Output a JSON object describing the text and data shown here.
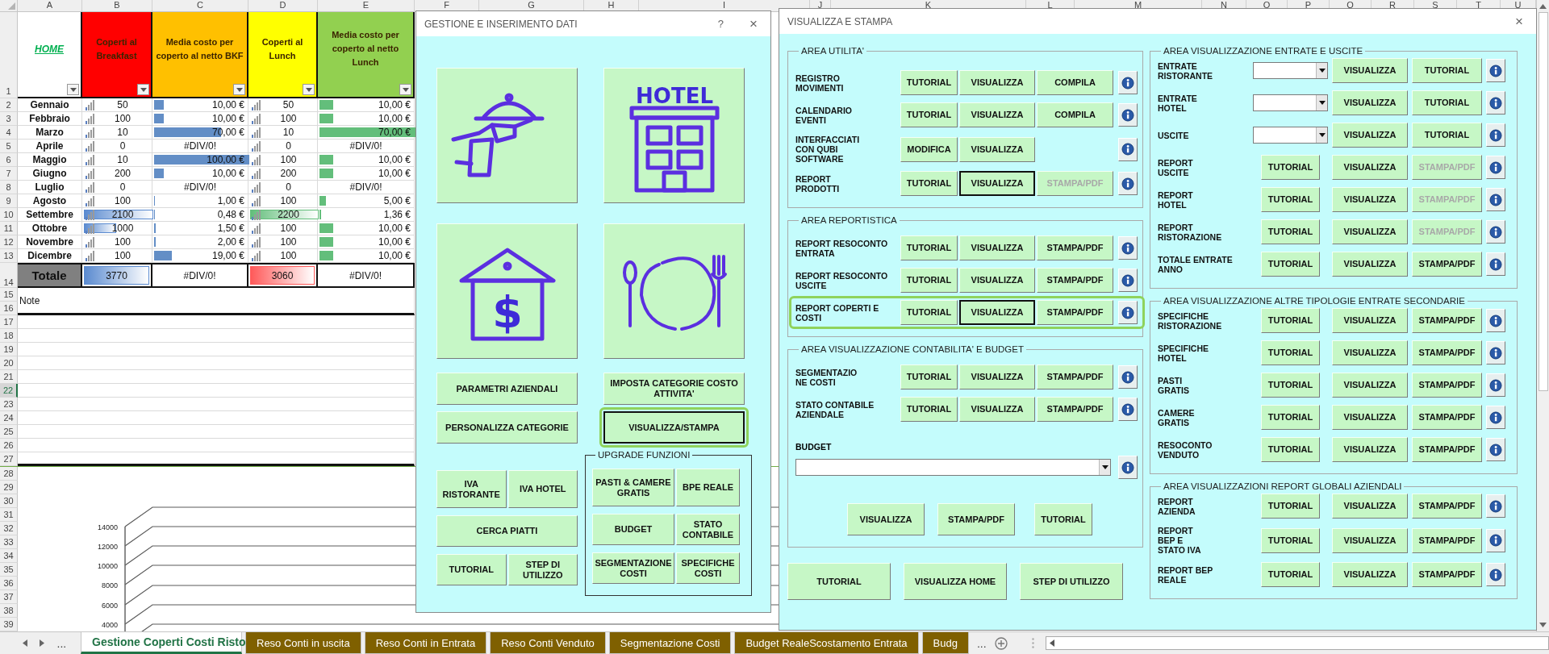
{
  "sheet": {
    "columns": [
      "A",
      "B",
      "C",
      "D",
      "E",
      "F",
      "G",
      "H",
      "I",
      "J",
      "K",
      "L",
      "M",
      "N",
      "O",
      "P",
      "Q",
      "R",
      "S",
      "T",
      "U"
    ],
    "header_row": "1",
    "header": [
      {
        "kind": "link",
        "text": "HOME"
      },
      {
        "kind": "title",
        "text": "Coperti al Breakfast",
        "color": "#ff0000"
      },
      {
        "kind": "title",
        "text": "Media costo per coperto al netto BKF",
        "color": "#ffc000"
      },
      {
        "kind": "title",
        "text": "Coperti al Lunch",
        "color": "#ffff00"
      },
      {
        "kind": "title",
        "text": "Media costo per coperto al netto Lunch",
        "color": "#92d050"
      }
    ],
    "rows": [
      {
        "row": "2",
        "cells": [
          {
            "kind": "label",
            "text": "Gennaio"
          },
          {
            "kind": "count",
            "text": "50"
          },
          {
            "kind": "cost",
            "text": "10,00 €",
            "level": 0.1
          },
          {
            "kind": "count",
            "text": "50"
          },
          {
            "kind": "cost",
            "text": "10,00 €",
            "level": 0.14
          }
        ]
      },
      {
        "row": "3",
        "cells": [
          {
            "kind": "label",
            "text": "Febbraio"
          },
          {
            "kind": "count",
            "text": "100"
          },
          {
            "kind": "cost",
            "text": "10,00 €",
            "level": 0.1
          },
          {
            "kind": "count",
            "text": "100"
          },
          {
            "kind": "cost",
            "text": "10,00 €",
            "level": 0.14
          }
        ]
      },
      {
        "row": "4",
        "cells": [
          {
            "kind": "label",
            "text": "Marzo"
          },
          {
            "kind": "count",
            "text": "10"
          },
          {
            "kind": "cost",
            "text": "70,00 €",
            "level": 0.7
          },
          {
            "kind": "count",
            "text": "10"
          },
          {
            "kind": "cost",
            "text": "70,00 €",
            "level": 1
          }
        ]
      },
      {
        "row": "5",
        "cells": [
          {
            "kind": "label",
            "text": "Aprile"
          },
          {
            "kind": "count",
            "text": "0"
          },
          {
            "kind": "error",
            "text": "#DIV/0!"
          },
          {
            "kind": "count",
            "text": "0"
          },
          {
            "kind": "error",
            "text": "#DIV/0!"
          }
        ]
      },
      {
        "row": "6",
        "cells": [
          {
            "kind": "label",
            "text": "Maggio"
          },
          {
            "kind": "count",
            "text": "10"
          },
          {
            "kind": "cost",
            "text": "100,00 €",
            "level": 1
          },
          {
            "kind": "count",
            "text": "100"
          },
          {
            "kind": "cost",
            "text": "10,00 €",
            "level": 0.14
          }
        ]
      },
      {
        "row": "7",
        "cells": [
          {
            "kind": "label",
            "text": "Giugno"
          },
          {
            "kind": "count",
            "text": "200"
          },
          {
            "kind": "cost",
            "text": "10,00 €",
            "level": 0.1
          },
          {
            "kind": "count",
            "text": "200"
          },
          {
            "kind": "cost",
            "text": "10,00 €",
            "level": 0.14
          }
        ]
      },
      {
        "row": "8",
        "cells": [
          {
            "kind": "label",
            "text": "Luglio"
          },
          {
            "kind": "count",
            "text": "0"
          },
          {
            "kind": "error",
            "text": "#DIV/0!"
          },
          {
            "kind": "count",
            "text": "0"
          },
          {
            "kind": "error",
            "text": "#DIV/0!"
          }
        ]
      },
      {
        "row": "9",
        "cells": [
          {
            "kind": "label",
            "text": "Agosto"
          },
          {
            "kind": "count",
            "text": "100"
          },
          {
            "kind": "cost",
            "text": "1,00 €",
            "level": 0.01
          },
          {
            "kind": "count",
            "text": "100"
          },
          {
            "kind": "cost",
            "text": "5,00 €",
            "level": 0.07
          }
        ]
      },
      {
        "row": "10",
        "cells": [
          {
            "kind": "label",
            "text": "Settembre"
          },
          {
            "kind": "count",
            "text": "2100",
            "level": 1
          },
          {
            "kind": "cost",
            "text": "0,48 €",
            "level": 0.01
          },
          {
            "kind": "count",
            "text": "2200",
            "level": 1
          },
          {
            "kind": "cost",
            "text": "1,36 €",
            "level": 0.02
          }
        ]
      },
      {
        "row": "11",
        "cells": [
          {
            "kind": "label",
            "text": "Ottobre"
          },
          {
            "kind": "count",
            "text": "1000",
            "level": 0.47
          },
          {
            "kind": "cost",
            "text": "1,50 €",
            "level": 0.015
          },
          {
            "kind": "count",
            "text": "100"
          },
          {
            "kind": "cost",
            "text": "10,00 €",
            "level": 0.14
          }
        ]
      },
      {
        "row": "12",
        "cells": [
          {
            "kind": "label",
            "text": "Novembre"
          },
          {
            "kind": "count",
            "text": "100"
          },
          {
            "kind": "cost",
            "text": "2,00 €",
            "level": 0.02
          },
          {
            "kind": "count",
            "text": "100"
          },
          {
            "kind": "cost",
            "text": "10,00 €",
            "level": 0.14
          }
        ]
      },
      {
        "row": "13",
        "cells": [
          {
            "kind": "label",
            "text": "Dicembre"
          },
          {
            "kind": "count",
            "text": "100"
          },
          {
            "kind": "cost",
            "text": "19,00 €",
            "level": 0.19
          },
          {
            "kind": "count",
            "text": "100"
          },
          {
            "kind": "cost",
            "text": "10,00 €",
            "level": 0.14
          }
        ]
      }
    ],
    "total": {
      "row": "14",
      "cells": [
        {
          "kind": "label",
          "text": "Totale"
        },
        {
          "kind": "total",
          "text": "3770",
          "color": "#5b8bd0"
        },
        {
          "kind": "error",
          "text": "#DIV/0!"
        },
        {
          "kind": "total",
          "text": "3060",
          "color": "#ff5a5a"
        },
        {
          "kind": "error",
          "text": "#DIV/0!"
        }
      ]
    },
    "note": {
      "rows": [
        "15",
        "16"
      ],
      "text": "Note"
    },
    "blank_rows": [
      {
        "row": "17",
        "selected": false
      },
      {
        "row": "18",
        "selected": false
      },
      {
        "row": "19",
        "selected": false
      },
      {
        "row": "20",
        "selected": false
      },
      {
        "row": "21",
        "selected": false
      },
      {
        "row": "22",
        "selected": true
      },
      {
        "row": "23",
        "selected": false
      },
      {
        "row": "24",
        "selected": false
      },
      {
        "row": "25",
        "selected": false
      },
      {
        "row": "26",
        "selected": false
      },
      {
        "row": "27",
        "selected": false
      }
    ],
    "chart": {
      "rows": [
        "28",
        "29",
        "30",
        "31",
        "32",
        "33",
        "34",
        "35",
        "36",
        "37",
        "38",
        "39"
      ],
      "tick_labels": [
        "14000",
        "12000",
        "10000",
        "8000",
        "6000",
        "4000"
      ]
    }
  },
  "sheet_tabs": [
    {
      "label": "Gestione Coperti Costi Risto",
      "selected": true
    },
    {
      "label": "Reso Conti in uscita",
      "selected": false
    },
    {
      "label": "Reso Conti in Entrata",
      "selected": false
    },
    {
      "label": "Reso Conti Venduto",
      "selected": false
    },
    {
      "label": "Segmentazione Costi",
      "selected": false
    },
    {
      "label": "Budget RealeScostamento Entrata",
      "selected": false
    },
    {
      "label": "Budg",
      "selected": false
    }
  ],
  "tab_bar": {
    "more_left": "...",
    "more_right": "..."
  },
  "gestione": {
    "title": "GESTIONE E INSERIMENTO DATI",
    "help": "?",
    "close": "×",
    "tiles": [
      {
        "kind": "waiter"
      },
      {
        "kind": "hotel",
        "sign": "HOTEL"
      },
      {
        "kind": "money_house",
        "sign": "$"
      },
      {
        "kind": "dining"
      }
    ],
    "setup_buttons": [
      {
        "label": "PARAMETRI AZIENDALI"
      },
      {
        "label": "PERSONALIZZA CATEGORIE"
      },
      {
        "label": "IMPOSTA CATEGORIE COSTO ATTIVITA'"
      },
      {
        "label": "VISUALIZZA/STAMPA",
        "highlighted": true,
        "focused": true
      }
    ],
    "tool_rows": [
      [
        {
          "label": "IVA RISTORANTE"
        },
        {
          "label": "IVA HOTEL"
        }
      ],
      [
        {
          "label": "CERCA PIATTI"
        }
      ],
      [
        {
          "label": "TUTORIAL"
        },
        {
          "label": "STEP DI UTILIZZO"
        }
      ]
    ],
    "upgrade": {
      "title": "UPGRADE FUNZIONI",
      "rows": [
        [
          {
            "label": "PASTI & CAMERE GRATIS"
          },
          {
            "label": "BPE REALE"
          }
        ],
        [
          {
            "label": "BUDGET"
          },
          {
            "label": "STATO CONTABILE"
          }
        ],
        [
          {
            "label": "SEGMENTAZIONE COSTI"
          },
          {
            "label": "SPECIFICHE COSTI"
          }
        ]
      ]
    }
  },
  "visualizza": {
    "title": "VISUALIZZA E STAMPA",
    "close": "×",
    "left_groups": [
      {
        "title": "AREA UTILITA'",
        "rows": [
          {
            "label": "REGISTRO\nMOVIMENTI",
            "controls": [
              {
                "kind": "button",
                "label": "TUTORIAL"
              },
              {
                "kind": "button",
                "label": "VISUALIZZA"
              },
              {
                "kind": "button",
                "label": "COMPILA"
              },
              {
                "kind": "info"
              }
            ]
          },
          {
            "label": "CALENDARIO\nEVENTI",
            "controls": [
              {
                "kind": "button",
                "label": "TUTORIAL"
              },
              {
                "kind": "button",
                "label": "VISUALIZZA"
              },
              {
                "kind": "button",
                "label": "COMPILA"
              },
              {
                "kind": "info"
              }
            ]
          },
          {
            "label": "INTERFACCIATI\nCON QUBI\nSOFTWARE",
            "controls": [
              {
                "kind": "button",
                "label": "MODIFICA"
              },
              {
                "kind": "button",
                "label": "VISUALIZZA"
              },
              {
                "kind": "info"
              }
            ]
          },
          {
            "label": "REPORT\nPRODOTTI",
            "controls": [
              {
                "kind": "button",
                "label": "TUTORIAL"
              },
              {
                "kind": "button",
                "label": "VISUALIZZA",
                "focused": true
              },
              {
                "kind": "button",
                "label": "STAMPA/PDF",
                "disabled": true
              },
              {
                "kind": "info"
              }
            ]
          }
        ]
      },
      {
        "title": "AREA REPORTISTICA",
        "rows": [
          {
            "label": "REPORT RESOCONTO\nENTRATA",
            "controls": [
              {
                "kind": "button",
                "label": "TUTORIAL"
              },
              {
                "kind": "button",
                "label": "VISUALIZZA"
              },
              {
                "kind": "button",
                "label": "STAMPA/PDF"
              },
              {
                "kind": "info"
              }
            ]
          },
          {
            "label": "REPORT RESOCONTO\nUSCITE",
            "controls": [
              {
                "kind": "button",
                "label": "TUTORIAL"
              },
              {
                "kind": "button",
                "label": "VISUALIZZA"
              },
              {
                "kind": "button",
                "label": "STAMPA/PDF"
              },
              {
                "kind": "info"
              }
            ]
          },
          {
            "label": "REPORT COPERTI E\nCOSTI",
            "highlighted": true,
            "controls": [
              {
                "kind": "button",
                "label": "TUTORIAL"
              },
              {
                "kind": "button",
                "label": "VISUALIZZA",
                "focused": true
              },
              {
                "kind": "button",
                "label": "STAMPA/PDF"
              },
              {
                "kind": "info"
              }
            ]
          }
        ]
      },
      {
        "title": "AREA VISUALIZZAZIONE CONTABILITA' E BUDGET",
        "rows": [
          {
            "label": "SEGMENTAZIO\nNE COSTI",
            "controls": [
              {
                "kind": "button",
                "label": "TUTORIAL"
              },
              {
                "kind": "button",
                "label": "VISUALIZZA"
              },
              {
                "kind": "button",
                "label": "STAMPA/PDF"
              },
              {
                "kind": "info"
              }
            ]
          },
          {
            "label": "STATO CONTABILE\nAZIENDALE",
            "controls": [
              {
                "kind": "button",
                "label": "TUTORIAL"
              },
              {
                "kind": "button",
                "label": "VISUALIZZA"
              },
              {
                "kind": "button",
                "label": "STAMPA/PDF"
              },
              {
                "kind": "info"
              }
            ]
          }
        ],
        "budget": {
          "label": "BUDGET",
          "controls": [
            {
              "kind": "dropdown"
            },
            {
              "kind": "info"
            }
          ],
          "buttons": [
            {
              "label": "VISUALIZZA"
            },
            {
              "label": "STAMPA/PDF"
            },
            {
              "label": "TUTORIAL"
            }
          ]
        }
      }
    ],
    "footer_buttons": [
      {
        "label": "TUTORIAL"
      },
      {
        "label": "VISUALIZZA HOME"
      },
      {
        "label": "STEP DI UTILIZZO"
      }
    ],
    "right_groups": [
      {
        "title": "AREA VISUALIZZAZIONE ENTRATE E USCITE",
        "rows": [
          {
            "label": "ENTRATE\nRISTORANTE",
            "controls": [
              {
                "kind": "dropdown"
              },
              {
                "kind": "button",
                "label": "VISUALIZZA"
              },
              {
                "kind": "button",
                "label": "TUTORIAL"
              },
              {
                "kind": "info"
              }
            ]
          },
          {
            "label": "ENTRATE\nHOTEL",
            "controls": [
              {
                "kind": "dropdown"
              },
              {
                "kind": "button",
                "label": "VISUALIZZA"
              },
              {
                "kind": "button",
                "label": "TUTORIAL"
              },
              {
                "kind": "info"
              }
            ]
          },
          {
            "label": "USCITE",
            "controls": [
              {
                "kind": "dropdown"
              },
              {
                "kind": "button",
                "label": "VISUALIZZA"
              },
              {
                "kind": "button",
                "label": "TUTORIAL"
              },
              {
                "kind": "info"
              }
            ]
          },
          {
            "label": "REPORT\nUSCITE",
            "controls": [
              {
                "kind": "button",
                "label": "TUTORIAL"
              },
              {
                "kind": "button",
                "label": "VISUALIZZA"
              },
              {
                "kind": "button",
                "label": "STAMPA/PDF",
                "disabled": true
              },
              {
                "kind": "info"
              }
            ]
          },
          {
            "label": "REPORT\nHOTEL",
            "controls": [
              {
                "kind": "button",
                "label": "TUTORIAL"
              },
              {
                "kind": "button",
                "label": "VISUALIZZA"
              },
              {
                "kind": "button",
                "label": "STAMPA/PDF",
                "disabled": true
              },
              {
                "kind": "info"
              }
            ]
          },
          {
            "label": "REPORT\nRISTORAZIONE",
            "controls": [
              {
                "kind": "button",
                "label": "TUTORIAL"
              },
              {
                "kind": "button",
                "label": "VISUALIZZA"
              },
              {
                "kind": "button",
                "label": "STAMPA/PDF",
                "disabled": true
              },
              {
                "kind": "info"
              }
            ]
          },
          {
            "label": "TOTALE ENTRATE\nANNO",
            "controls": [
              {
                "kind": "button",
                "label": "TUTORIAL"
              },
              {
                "kind": "button",
                "label": "VISUALIZZA"
              },
              {
                "kind": "button",
                "label": "STAMPA/PDF"
              },
              {
                "kind": "info"
              }
            ]
          }
        ]
      },
      {
        "title": "AREA VISUALIZZAZIONE ALTRE TIPOLOGIE ENTRATE SECONDARIE",
        "rows": [
          {
            "label": "SPECIFICHE\nRISTORAZIONE",
            "controls": [
              {
                "kind": "button",
                "label": "TUTORIAL"
              },
              {
                "kind": "button",
                "label": "VISUALIZZA"
              },
              {
                "kind": "button",
                "label": "STAMPA/PDF"
              },
              {
                "kind": "info"
              }
            ]
          },
          {
            "label": "SPECIFICHE\nHOTEL",
            "controls": [
              {
                "kind": "button",
                "label": "TUTORIAL"
              },
              {
                "kind": "button",
                "label": "VISUALIZZA"
              },
              {
                "kind": "button",
                "label": "STAMPA/PDF"
              },
              {
                "kind": "info"
              }
            ]
          },
          {
            "label": "PASTI\nGRATIS",
            "controls": [
              {
                "kind": "button",
                "label": "TUTORIAL"
              },
              {
                "kind": "button",
                "label": "VISUALIZZA"
              },
              {
                "kind": "button",
                "label": "STAMPA/PDF"
              },
              {
                "kind": "info"
              }
            ]
          },
          {
            "label": "CAMERE\nGRATIS",
            "controls": [
              {
                "kind": "button",
                "label": "TUTORIAL"
              },
              {
                "kind": "button",
                "label": "VISUALIZZA"
              },
              {
                "kind": "button",
                "label": "STAMPA/PDF"
              },
              {
                "kind": "info"
              }
            ]
          },
          {
            "label": "RESOCONTO\nVENDUTO",
            "controls": [
              {
                "kind": "button",
                "label": "TUTORIAL"
              },
              {
                "kind": "button",
                "label": "VISUALIZZA"
              },
              {
                "kind": "button",
                "label": "STAMPA/PDF"
              },
              {
                "kind": "info"
              }
            ]
          }
        ]
      },
      {
        "title": "AREA VISUALIZZAZIONI REPORT GLOBALI AZIENDALI",
        "rows": [
          {
            "label": "REPORT\nAZIENDA",
            "controls": [
              {
                "kind": "button",
                "label": "TUTORIAL"
              },
              {
                "kind": "button",
                "label": "VISUALIZZA"
              },
              {
                "kind": "button",
                "label": "STAMPA/PDF"
              },
              {
                "kind": "info"
              }
            ]
          },
          {
            "label": "REPORT\nBEP E\nSTATO IVA",
            "controls": [
              {
                "kind": "button",
                "label": "TUTORIAL"
              },
              {
                "kind": "button",
                "label": "VISUALIZZA"
              },
              {
                "kind": "button",
                "label": "STAMPA/PDF"
              },
              {
                "kind": "info"
              }
            ]
          },
          {
            "label": "REPORT BEP\nREALE",
            "controls": [
              {
                "kind": "button",
                "label": "TUTORIAL"
              },
              {
                "kind": "button",
                "label": "VISUALIZZA"
              },
              {
                "kind": "button",
                "label": "STAMPA/PDF"
              },
              {
                "kind": "info"
              }
            ]
          }
        ]
      }
    ]
  }
}
